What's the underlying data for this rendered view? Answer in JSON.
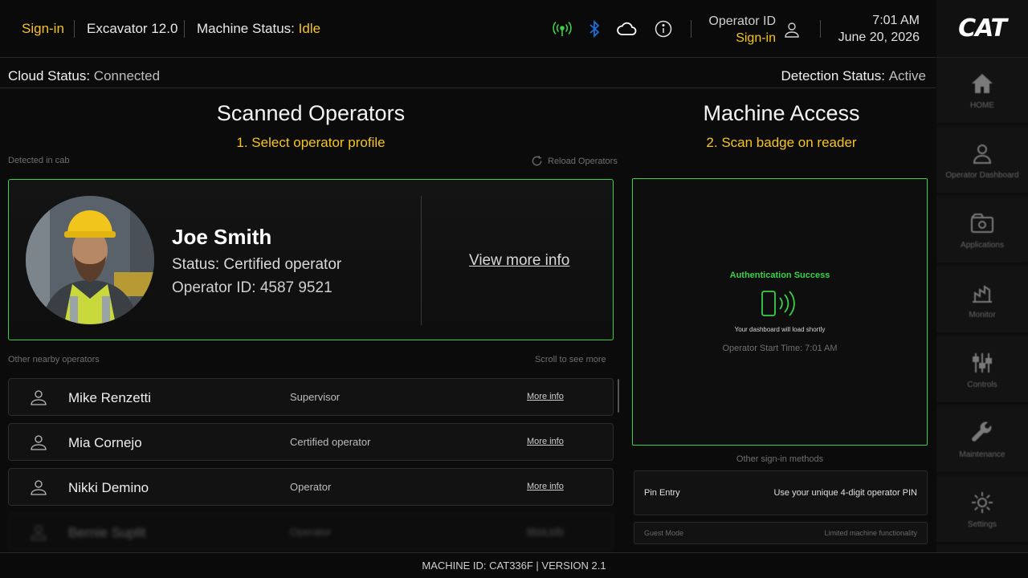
{
  "topbar": {
    "signin": "Sign-in",
    "machine": "Excavator 12.0",
    "status_label": "Machine Status:",
    "status_value": "Idle",
    "icons": [
      "signal-icon",
      "bluetooth-icon",
      "cloud-icon",
      "info-icon",
      "user-icon"
    ],
    "operator_id_label": "Operator ID",
    "operator_signin": "Sign-in",
    "time": "7:01 AM",
    "date": "June 20, 2026"
  },
  "brand": {
    "logo": "CAT"
  },
  "rail": {
    "items": [
      {
        "label": "HOME",
        "icon": "home-icon"
      },
      {
        "label": "Operator Dashboard",
        "icon": "operator-icon"
      },
      {
        "label": "Applications",
        "icon": "applications-icon"
      },
      {
        "label": "Monitor",
        "icon": "monitor-icon"
      },
      {
        "label": "Controls",
        "icon": "controls-icon"
      },
      {
        "label": "Maintenance",
        "icon": "wrench-icon"
      },
      {
        "label": "Settings",
        "icon": "gear-icon"
      }
    ]
  },
  "strip": {
    "cloud_label": "Cloud Status:",
    "cloud_value": "Connected",
    "detection_label": "Detection Status:",
    "detection_value": "Active"
  },
  "scanned": {
    "title": "Scanned Operators",
    "step": "1.  Select operator profile",
    "detected_label": "Detected in cab",
    "reload_label": "Reload Operators",
    "main": {
      "name": "Joe Smith",
      "status": "Status: Certified operator",
      "operator_id": "Operator ID:  4587 9521",
      "link": "View more info"
    },
    "nearby_label": "Other nearby operators",
    "scroll_hint": "Scroll to see more",
    "others": [
      {
        "name": "Mike Renzetti",
        "role": "Supervisor",
        "link": "More info"
      },
      {
        "name": "Mia Cornejo",
        "role": "Certified operator",
        "link": "More info"
      },
      {
        "name": "Nikki Demino",
        "role": "Operator",
        "link": "More info"
      },
      {
        "name": "Bernie Suplit",
        "role": "Operator",
        "link": "More info"
      }
    ]
  },
  "access": {
    "title": "Machine Access",
    "step": "2.  Scan badge on reader",
    "auth_title": "Authentication Success",
    "auth_sub": "Your dashboard will load shortly",
    "start_time": "Operator Start Time: 7:01 AM",
    "other_methods": "Other sign-in methods",
    "methods": [
      {
        "title": "Pin Entry",
        "desc": "Use your unique 4-digit operator PIN"
      },
      {
        "title": "Guest Mode",
        "desc": "Limited machine functionality"
      }
    ],
    "accent": "#3ad04a"
  },
  "footer": {
    "text": "MACHINE ID: CAT336F | VERSION 2.1"
  },
  "colors": {
    "yellow": "#f7c51c",
    "green": "#3ad04a",
    "bluetooth": "#1e6fd9",
    "background": "#0b0b0b"
  }
}
